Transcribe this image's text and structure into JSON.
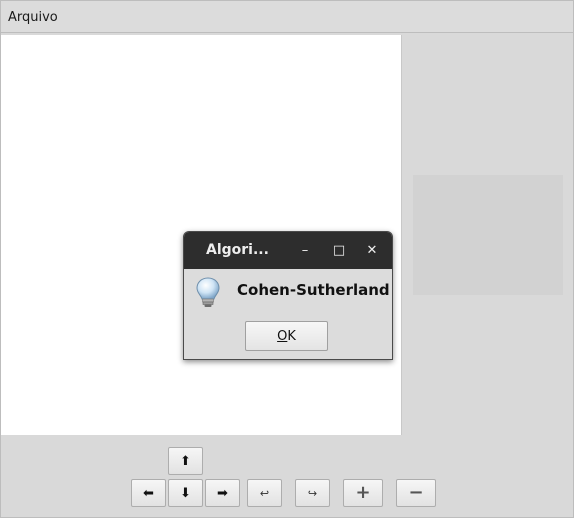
{
  "menubar": {
    "file_menu": "Arquivo"
  },
  "controls": {
    "up": "⬆",
    "left": "⬅",
    "down": "⬇",
    "right": "➡",
    "rotate_left": "↩",
    "rotate_right": "↪",
    "zoom_in": "+",
    "zoom_out": "−"
  },
  "dialog": {
    "title": "Algori...",
    "minimize": "–",
    "maximize": "□",
    "close": "✕",
    "message": "Cohen-Sutherland",
    "ok_mnemonic": "O",
    "ok_rest": "K"
  },
  "colors": {
    "window_bg": "#d9d9d9",
    "canvas_bg": "#ffffff",
    "titlebar_bg": "#2d2d2d"
  },
  "icons": {
    "info": "lightbulb-icon"
  }
}
